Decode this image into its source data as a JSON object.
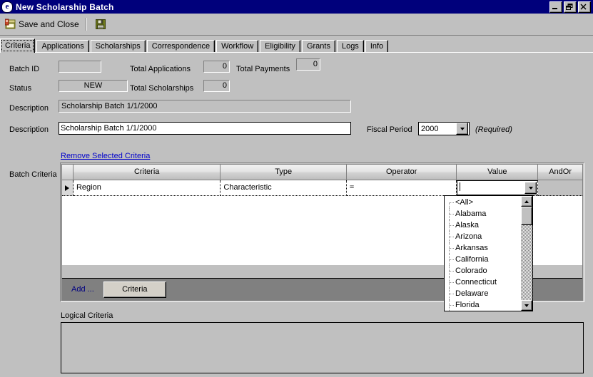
{
  "window": {
    "title": "New Scholarship Batch",
    "icon": "globe-icon",
    "minimize_label": "Minimize",
    "restore_label": "Restore",
    "close_label": "Close",
    "titlebar_color": "#00007b"
  },
  "toolbar": {
    "save_and_close_label": "Save and Close",
    "save_and_close_icon": "save-close-icon",
    "save_icon": "save-icon"
  },
  "tabs": [
    {
      "label": "Criteria",
      "selected": true
    },
    {
      "label": "Applications",
      "selected": false
    },
    {
      "label": "Scholarships",
      "selected": false
    },
    {
      "label": "Correspondence",
      "selected": false
    },
    {
      "label": "Workflow",
      "selected": false
    },
    {
      "label": "Eligibility",
      "selected": false
    },
    {
      "label": "Grants",
      "selected": false
    },
    {
      "label": "Logs",
      "selected": false
    },
    {
      "label": "Info",
      "selected": false
    }
  ],
  "form": {
    "batch_id_label": "Batch ID",
    "batch_id_value": "",
    "total_applications_label": "Total Applications",
    "total_applications_value": "0",
    "total_payments_label": "Total Payments",
    "total_payments_value": "0",
    "status_label": "Status",
    "status_value": "NEW",
    "total_scholarships_label": "Total Scholarships",
    "total_scholarships_value": "0",
    "description_readonly_label": "Description",
    "description_readonly_value": "Scholarship Batch 1/1/2000",
    "description_label": "Description",
    "description_value": "Scholarship Batch 1/1/2000",
    "description_placeholder": "",
    "fiscal_period_label": "Fiscal Period",
    "fiscal_period_value": "2000",
    "fiscal_period_required_note": "(Required)"
  },
  "criteria_section": {
    "remove_link_label": "Remove Selected Criteria",
    "batch_criteria_label": "Batch Criteria",
    "columns": [
      "Criteria",
      "Type",
      "Operator",
      "Value",
      "AndOr"
    ],
    "rows": [
      {
        "selector": "▶",
        "criteria": "Region",
        "type": "Characteristic",
        "operator": "=",
        "value": "",
        "andor": ""
      }
    ],
    "footer": {
      "add_label": "Add ...",
      "criteria_button_label": "Criteria"
    }
  },
  "value_dropdown": {
    "open": true,
    "selected": "",
    "options": [
      "<All>",
      "Alabama",
      "Alaska",
      "Arizona",
      "Arkansas",
      "California",
      "Colorado",
      "Connecticut",
      "Delaware",
      "Florida"
    ],
    "scroll_up_icon": "scroll-up-icon",
    "scroll_down_icon": "scroll-down-icon"
  },
  "logical_criteria": {
    "label": "Logical Criteria",
    "value": ""
  }
}
